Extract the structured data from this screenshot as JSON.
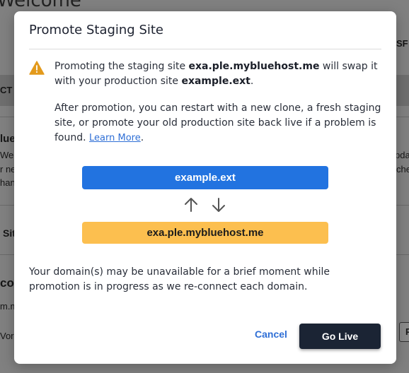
{
  "background": {
    "page_title": "Welcome",
    "fragments": [
      "SF",
      "CT",
      "lue",
      "We",
      "pda",
      "r ne",
      "che",
      "han",
      "Sit",
      "con",
      "m.m",
      "Vord",
      "P"
    ]
  },
  "modal": {
    "title": "Promote Staging Site",
    "p1": {
      "pre": "Promoting the staging site ",
      "staging_domain": "exa.ple.mybluehost.me",
      "mid": " will swap it with your production site ",
      "production_domain": "example.ext",
      "post": "."
    },
    "p2": {
      "text": "After promotion, you can restart with a new clone, a fresh staging site, or promote your old production site back live if a problem is found. ",
      "link": "Learn More",
      "post": "."
    },
    "production_box": "example.ext",
    "staging_box": "exa.ple.mybluehost.me",
    "p3": "Your domain(s) may be unavailable for a brief moment while promotion is in progress as we re-connect each domain.",
    "cancel_label": "Cancel",
    "golive_label": "Go Live"
  },
  "icons": {
    "warning": "warning-triangle-icon",
    "arrow_up": "arrow-up-icon",
    "arrow_down": "arrow-down-icon"
  },
  "colors": {
    "production": "#2273e0",
    "staging": "#fcbf4f",
    "primary_button": "#1b2434",
    "link": "#2f6fd6",
    "warning": "#e39a1c"
  }
}
